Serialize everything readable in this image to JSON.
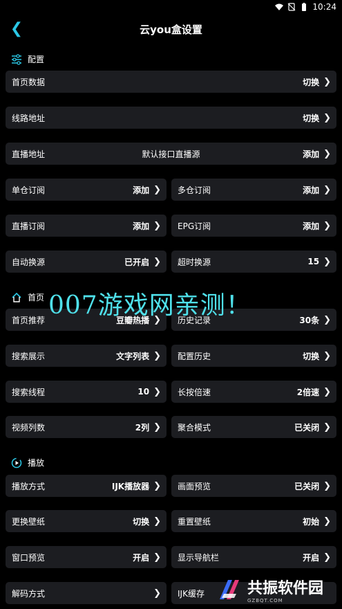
{
  "status_bar": {
    "time": "10:24"
  },
  "header": {
    "title": "云you盒设置"
  },
  "sections": {
    "config": "配置",
    "home": "首页",
    "play": "播放"
  },
  "config": {
    "home_data": {
      "label": "首页数据",
      "value": "切换"
    },
    "route": {
      "label": "线路地址",
      "value": "切换"
    },
    "live": {
      "label": "直播地址",
      "center": "默认接口直播源",
      "value": "添加"
    },
    "single_sub": {
      "label": "单仓订阅",
      "value": "添加"
    },
    "multi_sub": {
      "label": "多仓订阅",
      "value": "添加"
    },
    "live_sub": {
      "label": "直播订阅",
      "value": "添加"
    },
    "epg_sub": {
      "label": "EPG订阅",
      "value": "添加"
    },
    "auto_switch": {
      "label": "自动换源",
      "value": "已开启"
    },
    "timeout_switch": {
      "label": "超时换源",
      "value": "15"
    }
  },
  "home": {
    "recommend": {
      "label": "首页推荐",
      "value": "豆瓣热播"
    },
    "history": {
      "label": "历史记录",
      "value": "30条"
    },
    "search_display": {
      "label": "搜索展示",
      "value": "文字列表"
    },
    "config_history": {
      "label": "配置历史",
      "value": "切换"
    },
    "search_threads": {
      "label": "搜索线程",
      "value": "10"
    },
    "long_press": {
      "label": "长按倍速",
      "value": "2倍速"
    },
    "video_cols": {
      "label": "视频列数",
      "value": "2列"
    },
    "aggregate": {
      "label": "聚合模式",
      "value": "已关闭"
    }
  },
  "play": {
    "method": {
      "label": "播放方式",
      "value": "IJK播放器"
    },
    "preview": {
      "label": "画面预览",
      "value": "已关闭"
    },
    "wallpaper": {
      "label": "更换壁纸",
      "value": "切换"
    },
    "reset_wallpaper": {
      "label": "重置壁纸",
      "value": "初始"
    },
    "window_preview": {
      "label": "窗口预览",
      "value": "开启"
    },
    "nav_bar": {
      "label": "显示导航栏",
      "value": "开启"
    },
    "decode": {
      "label": "解码方式",
      "value": ""
    },
    "ijk_cache": {
      "label": "IJK缓存",
      "value": ""
    }
  },
  "watermark": {
    "text": "007游戏网亲测！"
  },
  "logo": {
    "main": "共振软件园",
    "sub": "GZBQT.COM"
  },
  "colors": {
    "accent": "#2bc8e6",
    "card_bg": "#1c1d21",
    "background": "#000000"
  },
  "icons": {
    "back": "chevron-left-icon",
    "config": "sliders-icon",
    "home": "home-icon",
    "play": "play-circle-icon",
    "row": "chevron-right-icon"
  }
}
